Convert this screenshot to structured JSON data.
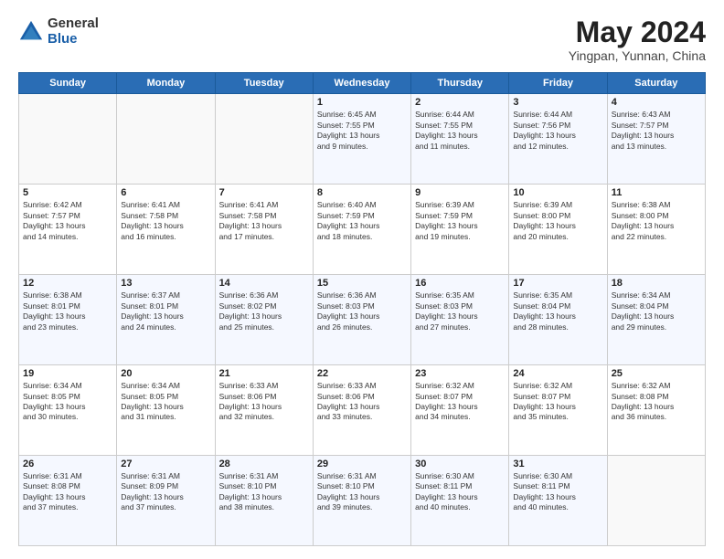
{
  "header": {
    "logo": {
      "general": "General",
      "blue": "Blue"
    },
    "title": "May 2024",
    "location": "Yingpan, Yunnan, China"
  },
  "weekdays": [
    "Sunday",
    "Monday",
    "Tuesday",
    "Wednesday",
    "Thursday",
    "Friday",
    "Saturday"
  ],
  "weeks": [
    [
      {
        "day": "",
        "info": ""
      },
      {
        "day": "",
        "info": ""
      },
      {
        "day": "",
        "info": ""
      },
      {
        "day": "1",
        "info": "Sunrise: 6:45 AM\nSunset: 7:55 PM\nDaylight: 13 hours\nand 9 minutes."
      },
      {
        "day": "2",
        "info": "Sunrise: 6:44 AM\nSunset: 7:55 PM\nDaylight: 13 hours\nand 11 minutes."
      },
      {
        "day": "3",
        "info": "Sunrise: 6:44 AM\nSunset: 7:56 PM\nDaylight: 13 hours\nand 12 minutes."
      },
      {
        "day": "4",
        "info": "Sunrise: 6:43 AM\nSunset: 7:57 PM\nDaylight: 13 hours\nand 13 minutes."
      }
    ],
    [
      {
        "day": "5",
        "info": "Sunrise: 6:42 AM\nSunset: 7:57 PM\nDaylight: 13 hours\nand 14 minutes."
      },
      {
        "day": "6",
        "info": "Sunrise: 6:41 AM\nSunset: 7:58 PM\nDaylight: 13 hours\nand 16 minutes."
      },
      {
        "day": "7",
        "info": "Sunrise: 6:41 AM\nSunset: 7:58 PM\nDaylight: 13 hours\nand 17 minutes."
      },
      {
        "day": "8",
        "info": "Sunrise: 6:40 AM\nSunset: 7:59 PM\nDaylight: 13 hours\nand 18 minutes."
      },
      {
        "day": "9",
        "info": "Sunrise: 6:39 AM\nSunset: 7:59 PM\nDaylight: 13 hours\nand 19 minutes."
      },
      {
        "day": "10",
        "info": "Sunrise: 6:39 AM\nSunset: 8:00 PM\nDaylight: 13 hours\nand 20 minutes."
      },
      {
        "day": "11",
        "info": "Sunrise: 6:38 AM\nSunset: 8:00 PM\nDaylight: 13 hours\nand 22 minutes."
      }
    ],
    [
      {
        "day": "12",
        "info": "Sunrise: 6:38 AM\nSunset: 8:01 PM\nDaylight: 13 hours\nand 23 minutes."
      },
      {
        "day": "13",
        "info": "Sunrise: 6:37 AM\nSunset: 8:01 PM\nDaylight: 13 hours\nand 24 minutes."
      },
      {
        "day": "14",
        "info": "Sunrise: 6:36 AM\nSunset: 8:02 PM\nDaylight: 13 hours\nand 25 minutes."
      },
      {
        "day": "15",
        "info": "Sunrise: 6:36 AM\nSunset: 8:03 PM\nDaylight: 13 hours\nand 26 minutes."
      },
      {
        "day": "16",
        "info": "Sunrise: 6:35 AM\nSunset: 8:03 PM\nDaylight: 13 hours\nand 27 minutes."
      },
      {
        "day": "17",
        "info": "Sunrise: 6:35 AM\nSunset: 8:04 PM\nDaylight: 13 hours\nand 28 minutes."
      },
      {
        "day": "18",
        "info": "Sunrise: 6:34 AM\nSunset: 8:04 PM\nDaylight: 13 hours\nand 29 minutes."
      }
    ],
    [
      {
        "day": "19",
        "info": "Sunrise: 6:34 AM\nSunset: 8:05 PM\nDaylight: 13 hours\nand 30 minutes."
      },
      {
        "day": "20",
        "info": "Sunrise: 6:34 AM\nSunset: 8:05 PM\nDaylight: 13 hours\nand 31 minutes."
      },
      {
        "day": "21",
        "info": "Sunrise: 6:33 AM\nSunset: 8:06 PM\nDaylight: 13 hours\nand 32 minutes."
      },
      {
        "day": "22",
        "info": "Sunrise: 6:33 AM\nSunset: 8:06 PM\nDaylight: 13 hours\nand 33 minutes."
      },
      {
        "day": "23",
        "info": "Sunrise: 6:32 AM\nSunset: 8:07 PM\nDaylight: 13 hours\nand 34 minutes."
      },
      {
        "day": "24",
        "info": "Sunrise: 6:32 AM\nSunset: 8:07 PM\nDaylight: 13 hours\nand 35 minutes."
      },
      {
        "day": "25",
        "info": "Sunrise: 6:32 AM\nSunset: 8:08 PM\nDaylight: 13 hours\nand 36 minutes."
      }
    ],
    [
      {
        "day": "26",
        "info": "Sunrise: 6:31 AM\nSunset: 8:08 PM\nDaylight: 13 hours\nand 37 minutes."
      },
      {
        "day": "27",
        "info": "Sunrise: 6:31 AM\nSunset: 8:09 PM\nDaylight: 13 hours\nand 37 minutes."
      },
      {
        "day": "28",
        "info": "Sunrise: 6:31 AM\nSunset: 8:10 PM\nDaylight: 13 hours\nand 38 minutes."
      },
      {
        "day": "29",
        "info": "Sunrise: 6:31 AM\nSunset: 8:10 PM\nDaylight: 13 hours\nand 39 minutes."
      },
      {
        "day": "30",
        "info": "Sunrise: 6:30 AM\nSunset: 8:11 PM\nDaylight: 13 hours\nand 40 minutes."
      },
      {
        "day": "31",
        "info": "Sunrise: 6:30 AM\nSunset: 8:11 PM\nDaylight: 13 hours\nand 40 minutes."
      },
      {
        "day": "",
        "info": ""
      }
    ]
  ]
}
